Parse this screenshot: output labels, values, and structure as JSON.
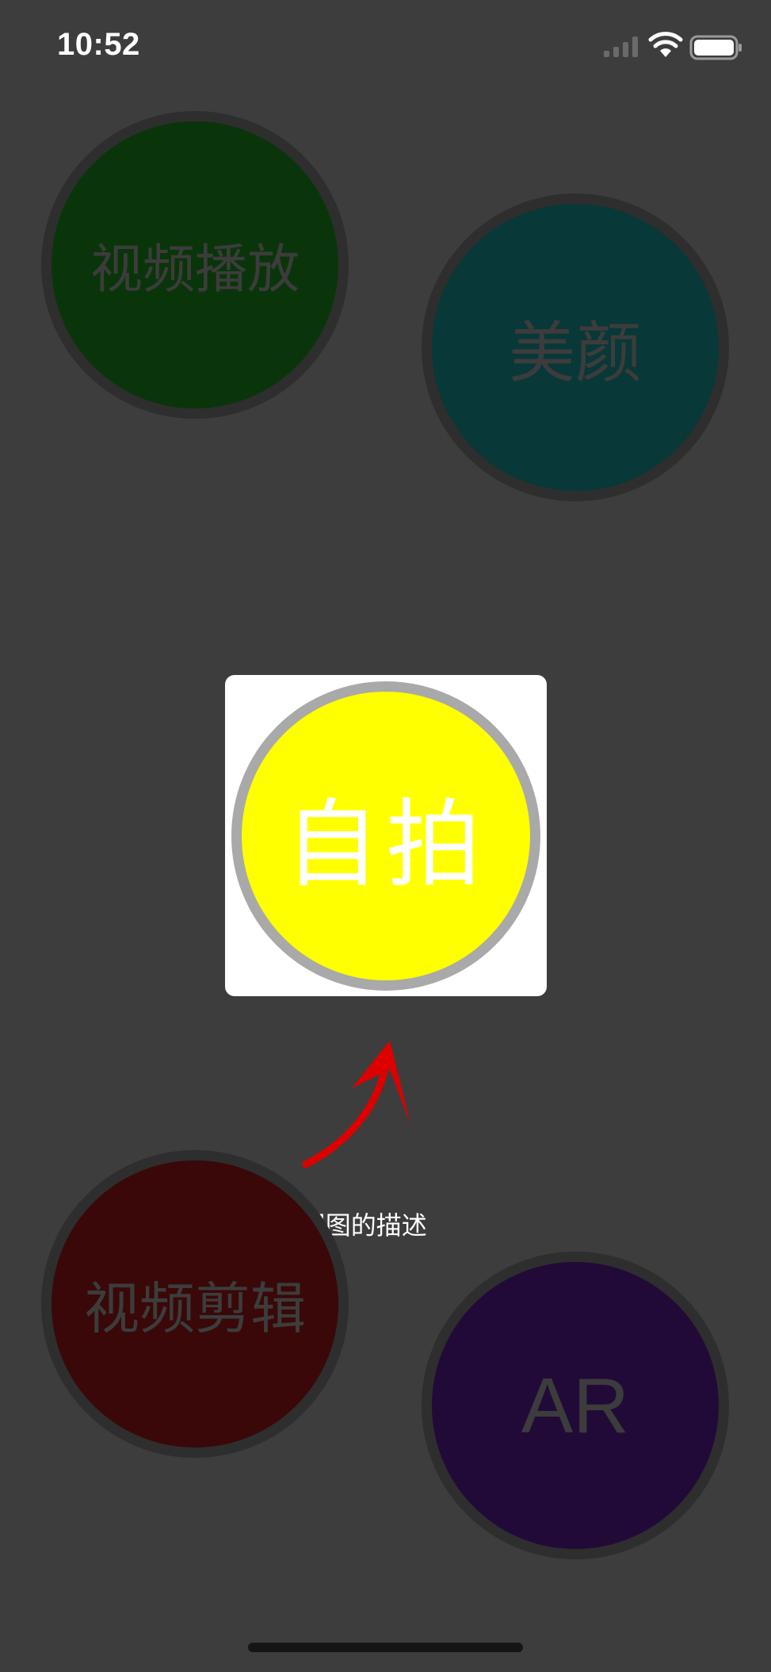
{
  "status_bar": {
    "time": "10:52",
    "icons": [
      "signal-icon",
      "wifi-icon",
      "battery-icon"
    ]
  },
  "bubbles": {
    "video_play": {
      "label": "视频播放",
      "color": "#0a350a"
    },
    "beauty": {
      "label": "美颜",
      "color": "#083838"
    },
    "video_edit": {
      "label": "视频剪辑",
      "color": "#3a0808"
    },
    "ar": {
      "label": "AR",
      "color": "#220a38"
    }
  },
  "highlight": {
    "label": "自拍",
    "color": "#ffff00",
    "description": "这是第 2 个视图的描述",
    "arrow_icon": "curved-arrow-up-icon",
    "arrow_color": "#dd0000"
  },
  "colors": {
    "background": "#3d3d3d",
    "bubble_border": "#2e2e2e",
    "highlight_border": "#a9a9a9"
  }
}
